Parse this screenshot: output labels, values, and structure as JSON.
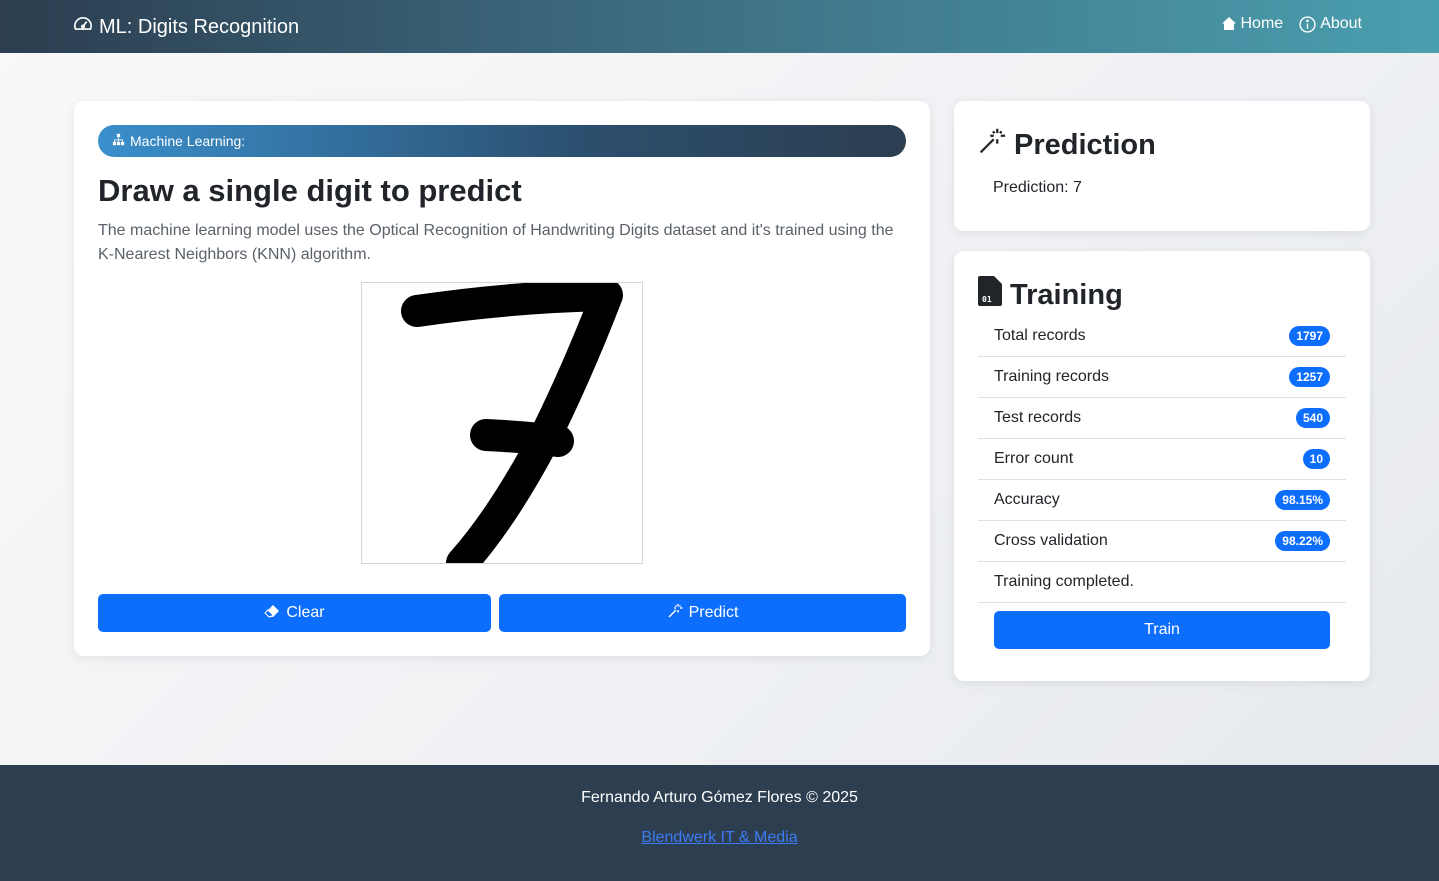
{
  "navbar": {
    "brand": "ML: Digits Recognition",
    "brand_icon": "speedometer-icon",
    "links": [
      {
        "label": "Home",
        "icon": "house-icon"
      },
      {
        "label": "About",
        "icon": "info-circle-icon"
      }
    ]
  },
  "main": {
    "badge": "Machine Learning:",
    "badge_icon": "diagram-icon",
    "title": "Draw a single digit to predict",
    "description": "The machine learning model uses the Optical Recognition of Handwriting Digits dataset and it's trained using the K-Nearest Neighbors (KNN) algorithm.",
    "drawn_digit": "7",
    "clear_label": "Clear",
    "predict_label": "Predict"
  },
  "prediction": {
    "title": "Prediction",
    "title_icon": "magic-wand-icon",
    "text": "Prediction: 7"
  },
  "training": {
    "title": "Training",
    "title_icon": "binary-file-icon",
    "rows": [
      {
        "label": "Total records",
        "value": "1797"
      },
      {
        "label": "Training records",
        "value": "1257"
      },
      {
        "label": "Test records",
        "value": "540"
      },
      {
        "label": "Error count",
        "value": "10"
      },
      {
        "label": "Accuracy",
        "value": "98.15%"
      },
      {
        "label": "Cross validation",
        "value": "98.22%"
      }
    ],
    "status": "Training completed.",
    "train_label": "Train"
  },
  "footer": {
    "copyright": "Fernando Arturo Gómez Flores © 2025",
    "link": "Blendwerk IT & Media"
  },
  "colors": {
    "primary": "#0d6efd",
    "navbar_start": "#2c3e50",
    "navbar_end": "#4a9faf",
    "footer": "#2c3e50"
  }
}
